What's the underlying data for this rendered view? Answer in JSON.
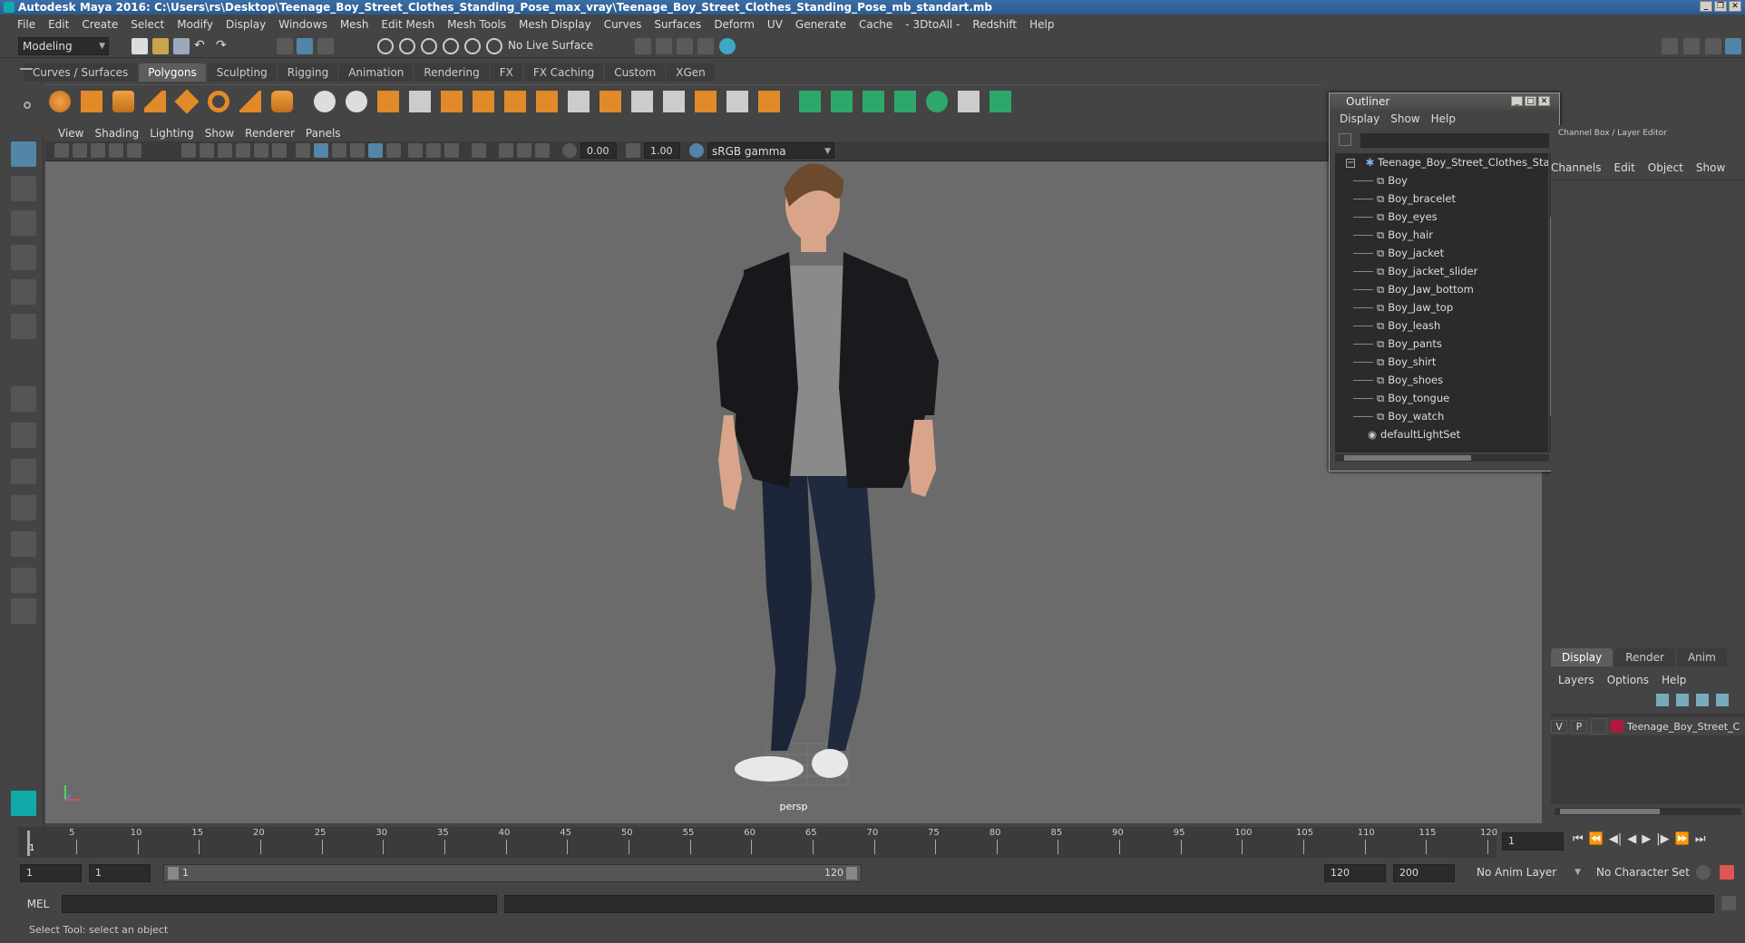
{
  "window": {
    "title": "Autodesk Maya 2016: C:\\Users\\rs\\Desktop\\Teenage_Boy_Street_Clothes_Standing_Pose_max_vray\\Teenage_Boy_Street_Clothes_Standing_Pose_mb_standart.mb"
  },
  "menubar": [
    "File",
    "Edit",
    "Create",
    "Select",
    "Modify",
    "Display",
    "Windows",
    "Mesh",
    "Edit Mesh",
    "Mesh Tools",
    "Mesh Display",
    "Curves",
    "Surfaces",
    "Deform",
    "UV",
    "Generate",
    "Cache",
    "- 3DtoAll -",
    "Redshift",
    "Help"
  ],
  "statusline": {
    "mode": "Modeling",
    "live_surface": "No Live Surface"
  },
  "shelf": {
    "tabs": [
      "Curves / Surfaces",
      "Polygons",
      "Sculpting",
      "Rigging",
      "Animation",
      "Rendering",
      "FX",
      "FX Caching",
      "Custom",
      "XGen"
    ],
    "active_tab": "Polygons"
  },
  "panel": {
    "menu": [
      "View",
      "Shading",
      "Lighting",
      "Show",
      "Renderer",
      "Panels"
    ],
    "exposure": "0.00",
    "gamma": "1.00",
    "color_space": "sRGB gamma",
    "camera": "persp"
  },
  "outliner": {
    "title": "Outliner",
    "menu": [
      "Display",
      "Show",
      "Help"
    ],
    "root": "Teenage_Boy_Street_Clothes_Star",
    "children": [
      "Boy",
      "Boy_bracelet",
      "Boy_eyes",
      "Boy_hair",
      "Boy_jacket",
      "Boy_jacket_slider",
      "Boy_Jaw_bottom",
      "Boy_Jaw_top",
      "Boy_leash",
      "Boy_pants",
      "Boy_shirt",
      "Boy_shoes",
      "Boy_tongue",
      "Boy_watch"
    ],
    "extra": "defaultLightSet"
  },
  "channelbox": {
    "header": "Channel Box / Layer Editor",
    "menu": [
      "Channels",
      "Edit",
      "Object",
      "Show"
    ]
  },
  "layers": {
    "tabs": [
      "Display",
      "Render",
      "Anim"
    ],
    "active_tab": "Display",
    "menu": [
      "Layers",
      "Options",
      "Help"
    ],
    "row": {
      "v": "V",
      "p": "P",
      "name": "Teenage_Boy_Street_C",
      "color": "#b0193a"
    }
  },
  "timeline": {
    "ticks": [
      "5",
      "10",
      "15",
      "20",
      "25",
      "30",
      "35",
      "40",
      "45",
      "50",
      "55",
      "60",
      "65",
      "70",
      "75",
      "80",
      "85",
      "90",
      "95",
      "100",
      "105",
      "110",
      "115",
      "120"
    ],
    "current_frame": "1",
    "current_field": "1"
  },
  "range": {
    "start": "1",
    "start2": "1",
    "slider_start": "1",
    "slider_end": "120",
    "end": "120",
    "end2": "200",
    "anim_layer": "No Anim Layer",
    "char_set": "No Character Set"
  },
  "cmd": {
    "label": "MEL"
  },
  "help": {
    "text": "Select Tool: select an object"
  },
  "colors": {
    "accent": "#5285a6",
    "viewport_bg": "#6b6b6b",
    "panel_bg": "#444444"
  }
}
